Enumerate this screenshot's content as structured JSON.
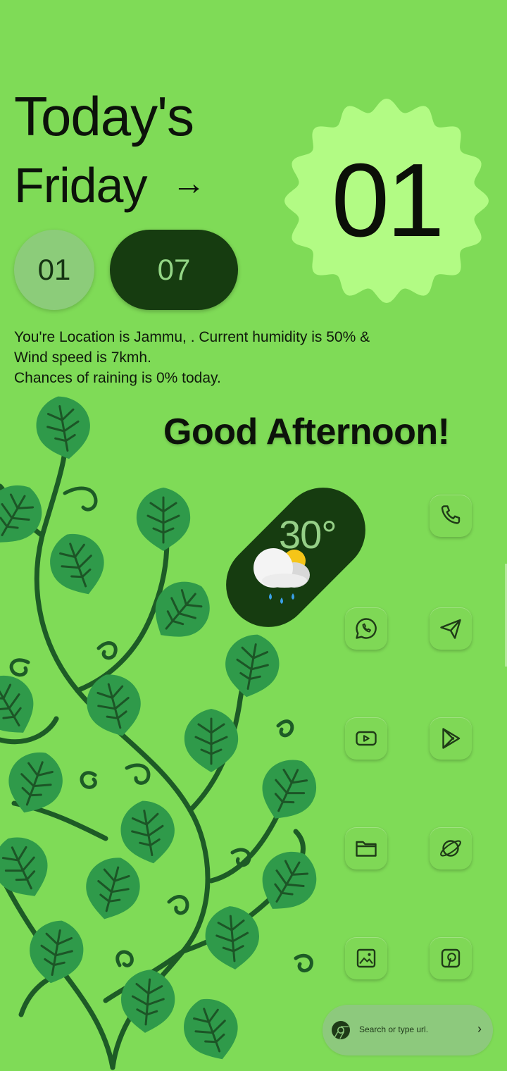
{
  "header": {
    "line1": "Today's",
    "line2": "Friday",
    "arrow": "→"
  },
  "badge": {
    "day": "01",
    "color": "#b2fb84"
  },
  "date_pills": {
    "left": "01",
    "right": "07"
  },
  "info": {
    "line1": "You're Location is Jammu, . Current humidity is 50% &",
    "line2": "Wind speed is 7kmh.",
    "line3": "Chances of raining is 0% today."
  },
  "greeting": "Good Afternoon!",
  "weather": {
    "temperature": "30°",
    "icon": "partly-cloudy-rain-icon"
  },
  "apps": [
    {
      "name": "phone",
      "icon": "phone-icon"
    },
    {
      "name": "whatsapp",
      "icon": "whatsapp-icon"
    },
    {
      "name": "telegram",
      "icon": "send-icon"
    },
    {
      "name": "youtube",
      "icon": "youtube-icon"
    },
    {
      "name": "play-store",
      "icon": "play-store-icon"
    },
    {
      "name": "files",
      "icon": "folder-icon"
    },
    {
      "name": "browser",
      "icon": "planet-icon"
    },
    {
      "name": "gallery",
      "icon": "image-icon"
    },
    {
      "name": "pinterest",
      "icon": "pinterest-icon"
    }
  ],
  "search": {
    "placeholder": "Search or type url.",
    "icon": "chrome-icon"
  },
  "colors": {
    "background": "#7fdb57",
    "dark": "#163c10",
    "leaf": "#2f9a4a",
    "vine": "#1d5b26"
  }
}
